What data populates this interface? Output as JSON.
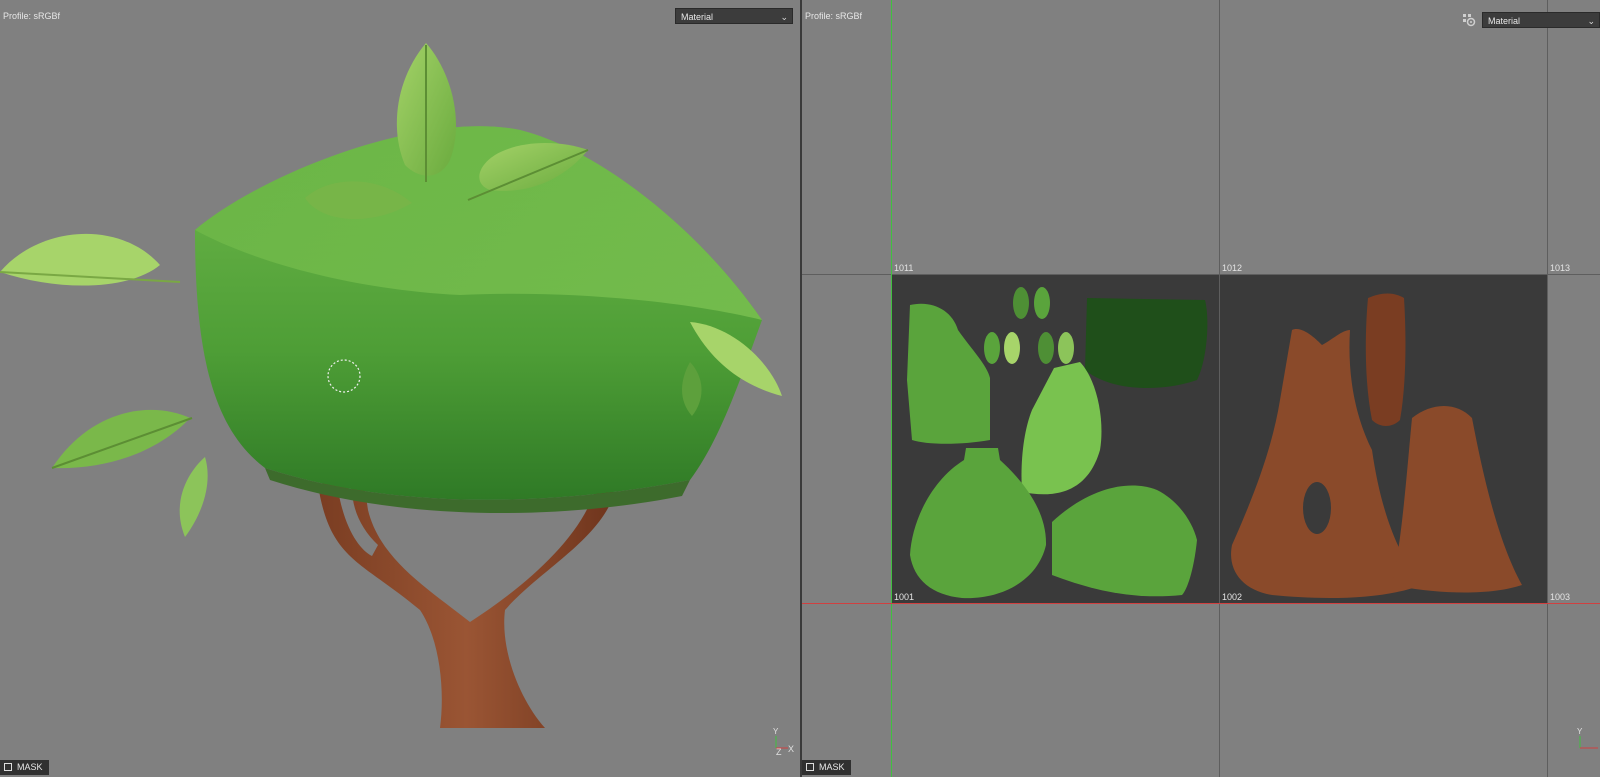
{
  "viewport_3d": {
    "profile": "Profile: sRGBf",
    "view_mode": "Material",
    "mask_label": "MASK",
    "axis": {
      "y": "Y",
      "z": "Z",
      "x": "X"
    }
  },
  "viewport_2d": {
    "profile": "Profile: sRGBf",
    "view_mode": "Material",
    "mask_label": "MASK",
    "axis": {
      "y": "Y"
    },
    "udim_tiles": [
      "1011",
      "1012",
      "1013",
      "1001",
      "1002",
      "1003"
    ]
  },
  "colors": {
    "viewport_bg": "#808080",
    "foliage": "#5aa43c",
    "bark": "#8a4a2a",
    "uv_tile_bg": "#3a3a3a",
    "u_axis": "#d04040",
    "v_axis": "#40c040"
  }
}
